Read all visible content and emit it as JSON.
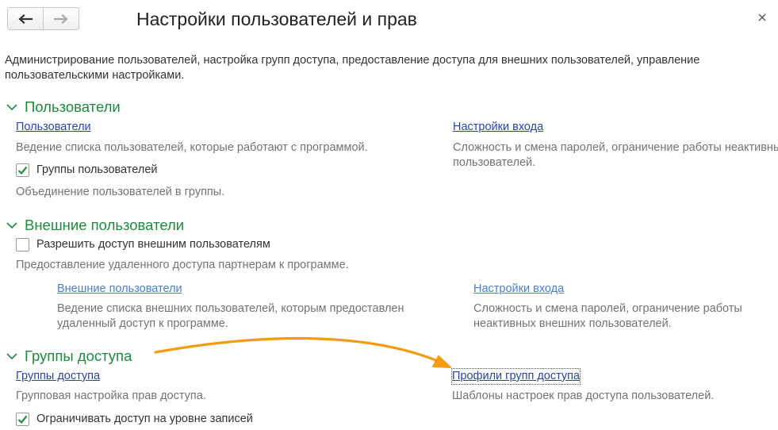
{
  "window": {
    "title": "Настройки пользователей и прав",
    "back_icon": "arrow-left-icon",
    "forward_icon": "arrow-right-icon",
    "close_icon": "close-icon"
  },
  "description": "Администрирование пользователей, настройка групп доступа, предоставление доступа для внешних пользователей, управление пользовательскими настройками.",
  "colors": {
    "section_title": "#1f8a3e",
    "link": "#2846a6",
    "hint": "#737373",
    "checkmark": "#2a8a3e",
    "annotation_arrow": "#f39c12"
  },
  "sections": {
    "users": {
      "title": "Пользователи",
      "users_link": "Пользователи",
      "users_hint": "Ведение списка пользователей, которые работают с программой.",
      "login_link": "Настройки входа",
      "login_hint": "Сложность и смена паролей, ограничение работы неактивных пользователей.",
      "groups_checkbox_label": "Группы пользователей",
      "groups_checkbox_checked": true,
      "groups_hint": "Объединение пользователей в группы."
    },
    "external": {
      "title": "Внешние пользователи",
      "allow_checkbox_label": "Разрешить доступ внешним пользователям",
      "allow_checkbox_checked": false,
      "allow_hint": "Предоставление удаленного доступа партнерам к программе.",
      "external_users_link": "Внешние пользователи",
      "external_users_hint": "Ведение списка внешних пользователей, которым предоставлен удаленный доступ к программе.",
      "login_link": "Настройки входа",
      "login_hint": "Сложность и смена паролей, ограничение работы неактивных внешних пользователей."
    },
    "access_groups": {
      "title": "Группы доступа",
      "groups_link": "Группы доступа",
      "groups_hint": "Групповая настройка прав доступа.",
      "profiles_link": "Профили групп доступа",
      "profiles_hint": "Шаблоны настроек прав доступа пользователей.",
      "record_level_checkbox_label": "Ограничивать доступ на уровне записей",
      "record_level_checkbox_checked": true
    }
  }
}
